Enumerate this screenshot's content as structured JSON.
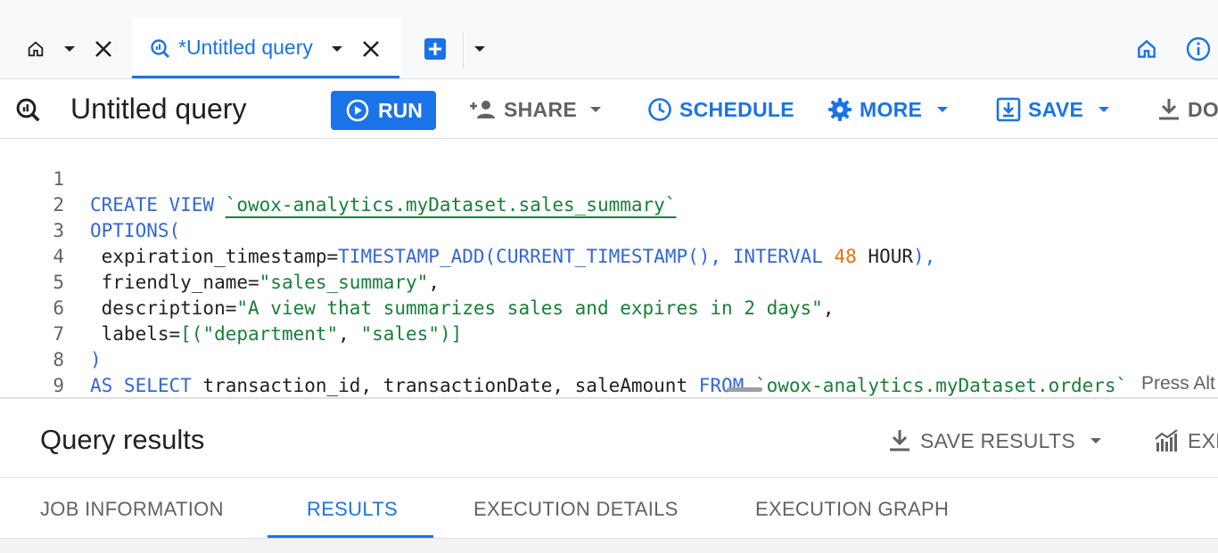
{
  "tabs": {
    "active_tab_title": "*Untitled query"
  },
  "toolbar": {
    "query_title": "Untitled query",
    "run_label": "RUN",
    "share_label": "SHARE",
    "schedule_label": "SCHEDULE",
    "more_label": "MORE",
    "save_label": "SAVE",
    "download_label": "DO"
  },
  "editor": {
    "lines": [
      {
        "n": "1"
      },
      {
        "n": "2"
      },
      {
        "n": "3"
      },
      {
        "n": "4"
      },
      {
        "n": "5"
      },
      {
        "n": "6"
      },
      {
        "n": "7"
      },
      {
        "n": "8"
      },
      {
        "n": "9"
      }
    ],
    "tokens": {
      "l1_kw": "CREATE VIEW ",
      "l1_tbl": "`owox-analytics.myDataset.sales_summary`",
      "l2_kw": "OPTIONS(",
      "l3_key": " expiration_timestamp=",
      "l3_fn1": "TIMESTAMP_ADD(",
      "l3_fn2": "CURRENT_TIMESTAMP(), ",
      "l3_kw": "INTERVAL ",
      "l3_num": "48",
      "l3_unit": " HOUR",
      "l3_close": "),",
      "l4_key": " friendly_name=",
      "l4_str": "\"sales_summary\"",
      "l4_end": ",",
      "l5_key": " description=",
      "l5_str": "\"A view that summarizes sales and expires in 2 days\"",
      "l5_end": ",",
      "l6_key": " labels=",
      "l6_br1": "[(",
      "l6_str1": "\"department\"",
      "l6_comma": ", ",
      "l6_str2": "\"sales\"",
      "l6_br2": ")]",
      "l7_close": ")",
      "l8_kw1": "AS SELECT ",
      "l8_cols": "transaction_id, transactionDate, saleAmount ",
      "l8_kw2": "FROM ",
      "l8_tbl": "`owox-analytics.myDataset.orders`"
    },
    "hint": "Press Alt"
  },
  "results": {
    "title": "Query results",
    "save_results_label": "SAVE RESULTS",
    "explore_label": "EXP",
    "tabs": {
      "job_information": "JOB INFORMATION",
      "results": "RESULTS",
      "execution_details": "EXECUTION DETAILS",
      "execution_graph": "EXECUTION GRAPH"
    }
  },
  "colors": {
    "accent": "#1a73e8",
    "keyword": "#3367d6",
    "string": "#188038",
    "number": "#e8710a"
  }
}
